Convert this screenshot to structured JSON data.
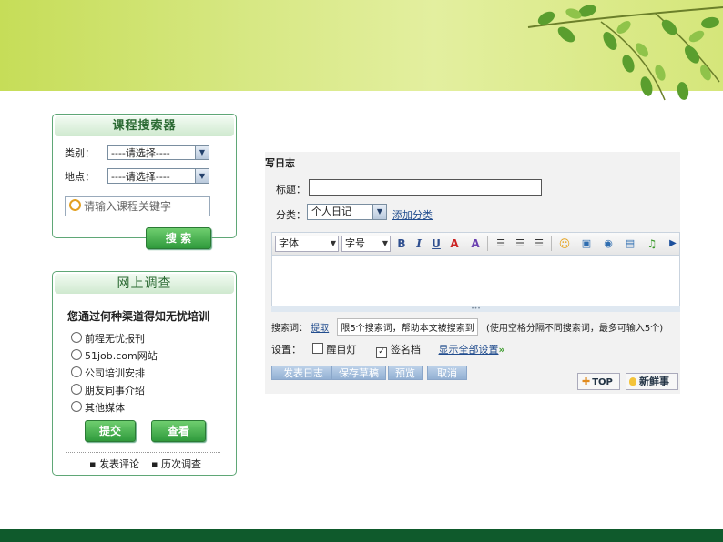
{
  "course_search": {
    "title": "课程搜索器",
    "category_label": "类别：",
    "category_value": "----请选择----",
    "location_label": "地点：",
    "location_value": "----请选择----",
    "keyword_placeholder": "请输入课程关键字",
    "search_button": "搜 索"
  },
  "survey": {
    "title": "网上调查",
    "question": "您通过何种渠道得知无忧培训",
    "options": [
      "前程无忧报刊",
      "51job.com网站",
      "公司培训安排",
      "朋友同事介绍",
      "其他媒体"
    ],
    "submit_button": "提交",
    "view_button": "查看",
    "links": [
      "发表评论",
      "历次调查"
    ]
  },
  "editor": {
    "header": "写日志",
    "title_label": "标题：",
    "category_label": "分类：",
    "category_value": "个人日记",
    "add_category": "添加分类",
    "font_select": "字体",
    "size_select": "字号",
    "keywords_label": "搜索词：",
    "extract_link": "提取",
    "keywords_placeholder": "限5个搜索词，帮助本文被搜索到",
    "keywords_hint": "(使用空格分隔不同搜索词，最多可输入5个)",
    "settings_label": "设置：",
    "setting_1": "醒目灯",
    "setting_2": "签名档",
    "show_all": "显示全部设置",
    "buttons": [
      "发表日志",
      "保存草稿",
      "预览",
      "取消"
    ],
    "top_button": "TOP",
    "new_button": "新鲜事"
  }
}
